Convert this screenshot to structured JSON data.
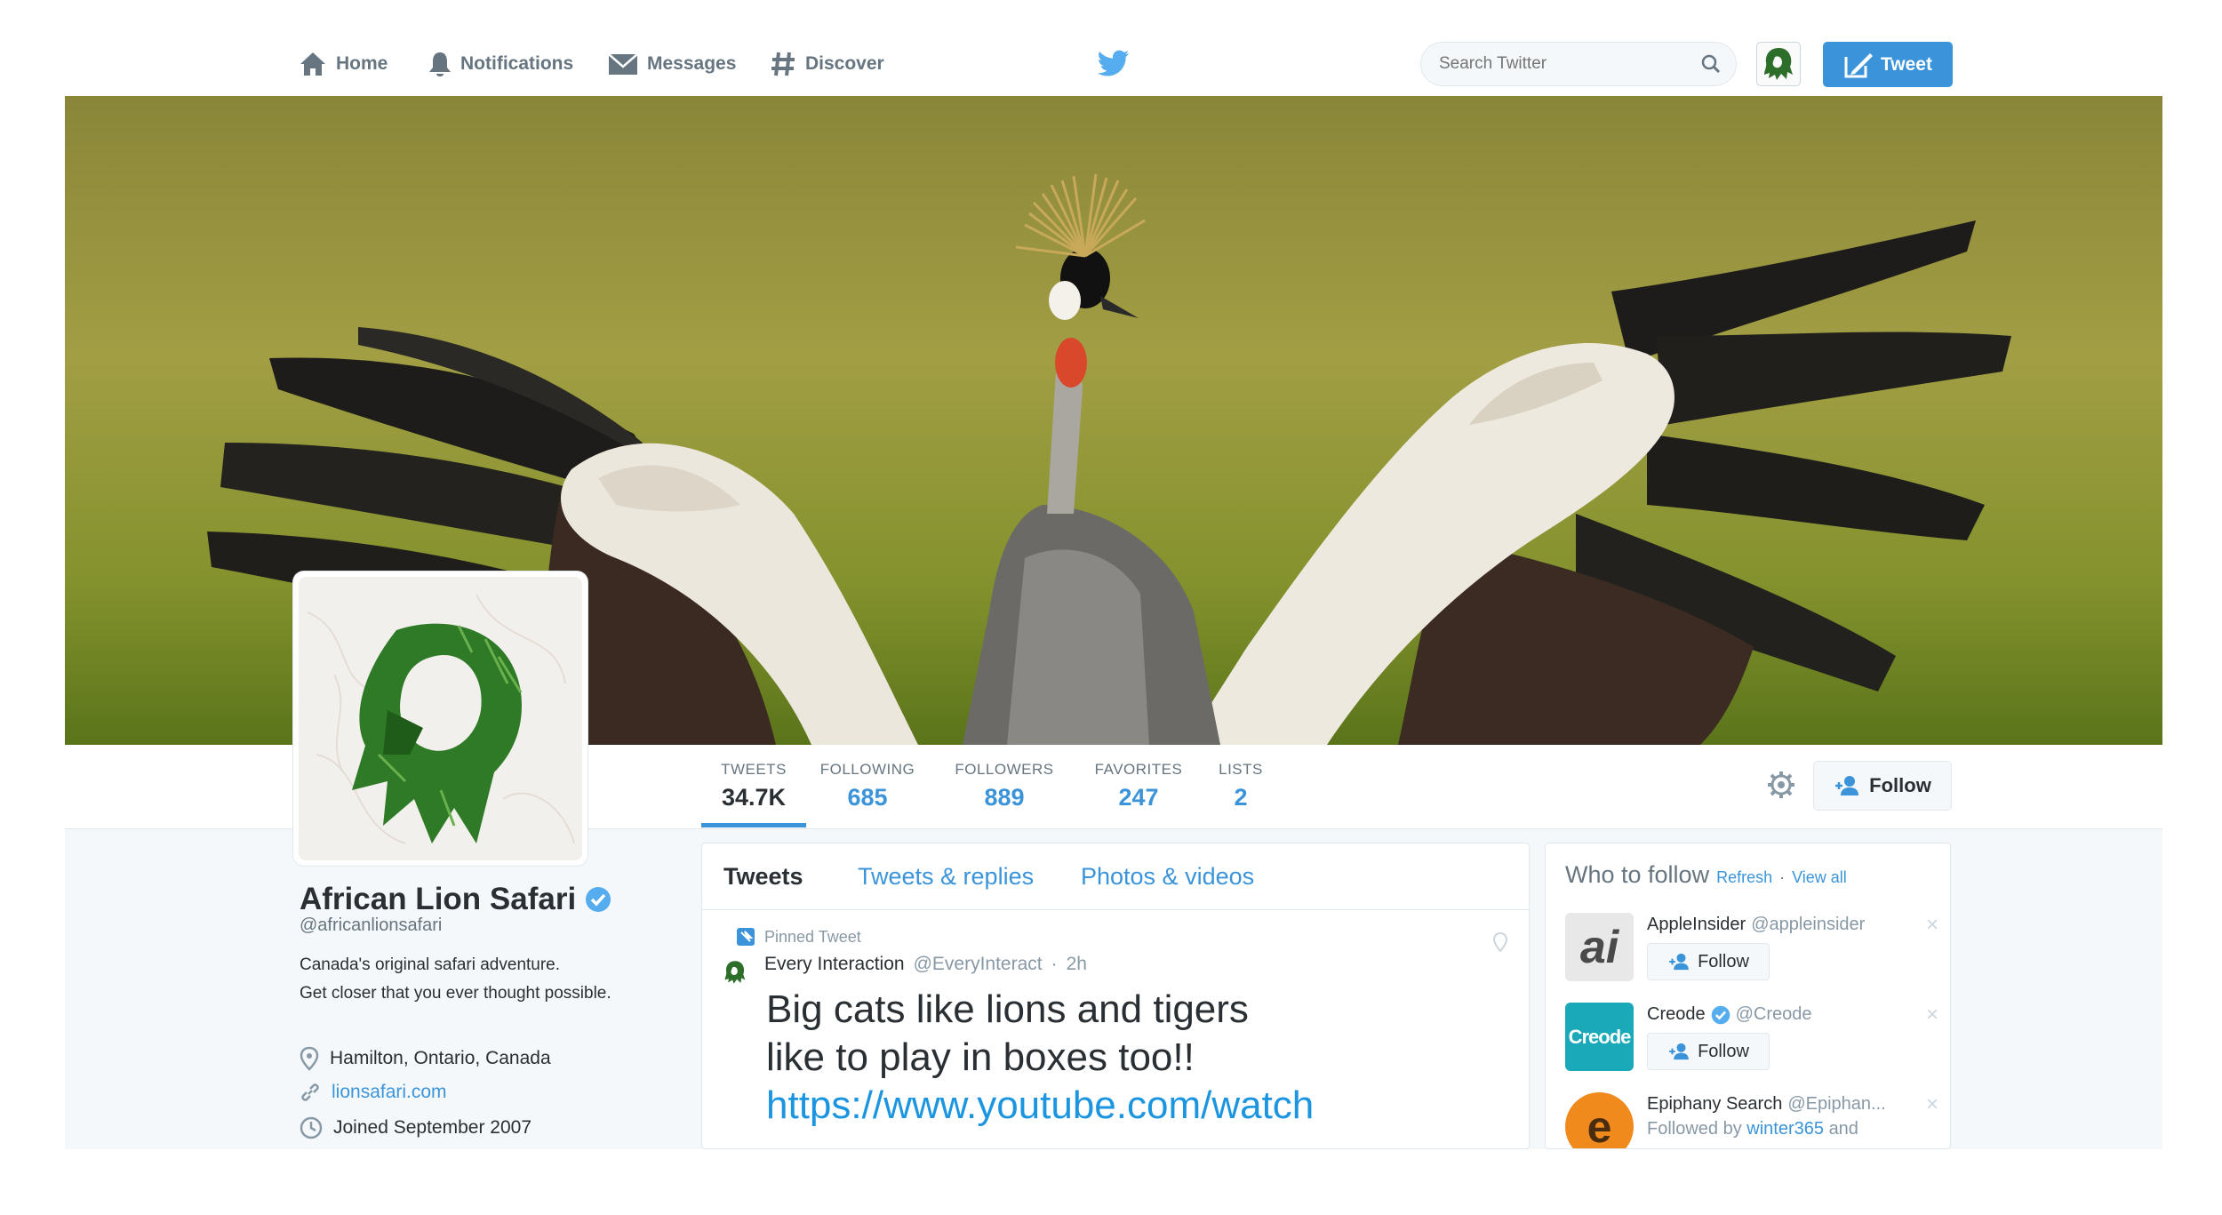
{
  "topnav": {
    "home": "Home",
    "notifications": "Notifications",
    "messages": "Messages",
    "discover": "Discover",
    "search_placeholder": "Search Twitter",
    "tweet_button": "Tweet"
  },
  "profile_nav": {
    "stats": [
      {
        "label": "TWEETS",
        "value": "34.7K"
      },
      {
        "label": "FOLLOWING",
        "value": "685"
      },
      {
        "label": "FOLLOWERS",
        "value": "889"
      },
      {
        "label": "FAVORITES",
        "value": "247"
      },
      {
        "label": "LISTS",
        "value": "2"
      }
    ],
    "follow_button": "Follow"
  },
  "profile": {
    "name": "African Lion Safari",
    "handle": "@africanlionsafari",
    "bio_line1": "Canada's original safari adventure.",
    "bio_line2": "Get closer that you ever thought possible.",
    "location": "Hamilton, Ontario, Canada",
    "website": "lionsafari.com",
    "joined": "Joined September 2007"
  },
  "timeline": {
    "tabs": [
      "Tweets",
      "Tweets & replies",
      "Photos & videos"
    ],
    "pinned_label": "Pinned Tweet",
    "tweet": {
      "author": "Every Interaction",
      "handle": "@EveryInteract",
      "separator": "·",
      "time": "2h",
      "line1": "Big cats like lions and tigers",
      "line2": "like to play in boxes too!!",
      "link": "https://www.youtube.com/watch"
    }
  },
  "who_to_follow": {
    "title": "Who to follow",
    "refresh": "Refresh",
    "dot": "·",
    "view_all": "View all",
    "suggestions": [
      {
        "name": "AppleInsider",
        "handle": "@appleinsider",
        "button": "Follow",
        "avatar_text": "ai"
      },
      {
        "name": "Creode",
        "handle": "@Creode",
        "button": "Follow",
        "avatar_text": "Creode"
      },
      {
        "name": "Epiphany Search",
        "handle": "@Epiphan...",
        "followed_by_prefix": "Followed by",
        "followed_by_user": "winter365",
        "followed_by_suffix": "and",
        "avatar_text": "e"
      }
    ],
    "close_glyph": "×"
  },
  "colors": {
    "accent": "#3b94d9",
    "text": "#292f33",
    "muted": "#66757f",
    "creode": "#1aa9b8",
    "epiphany": "#f08a1c"
  }
}
